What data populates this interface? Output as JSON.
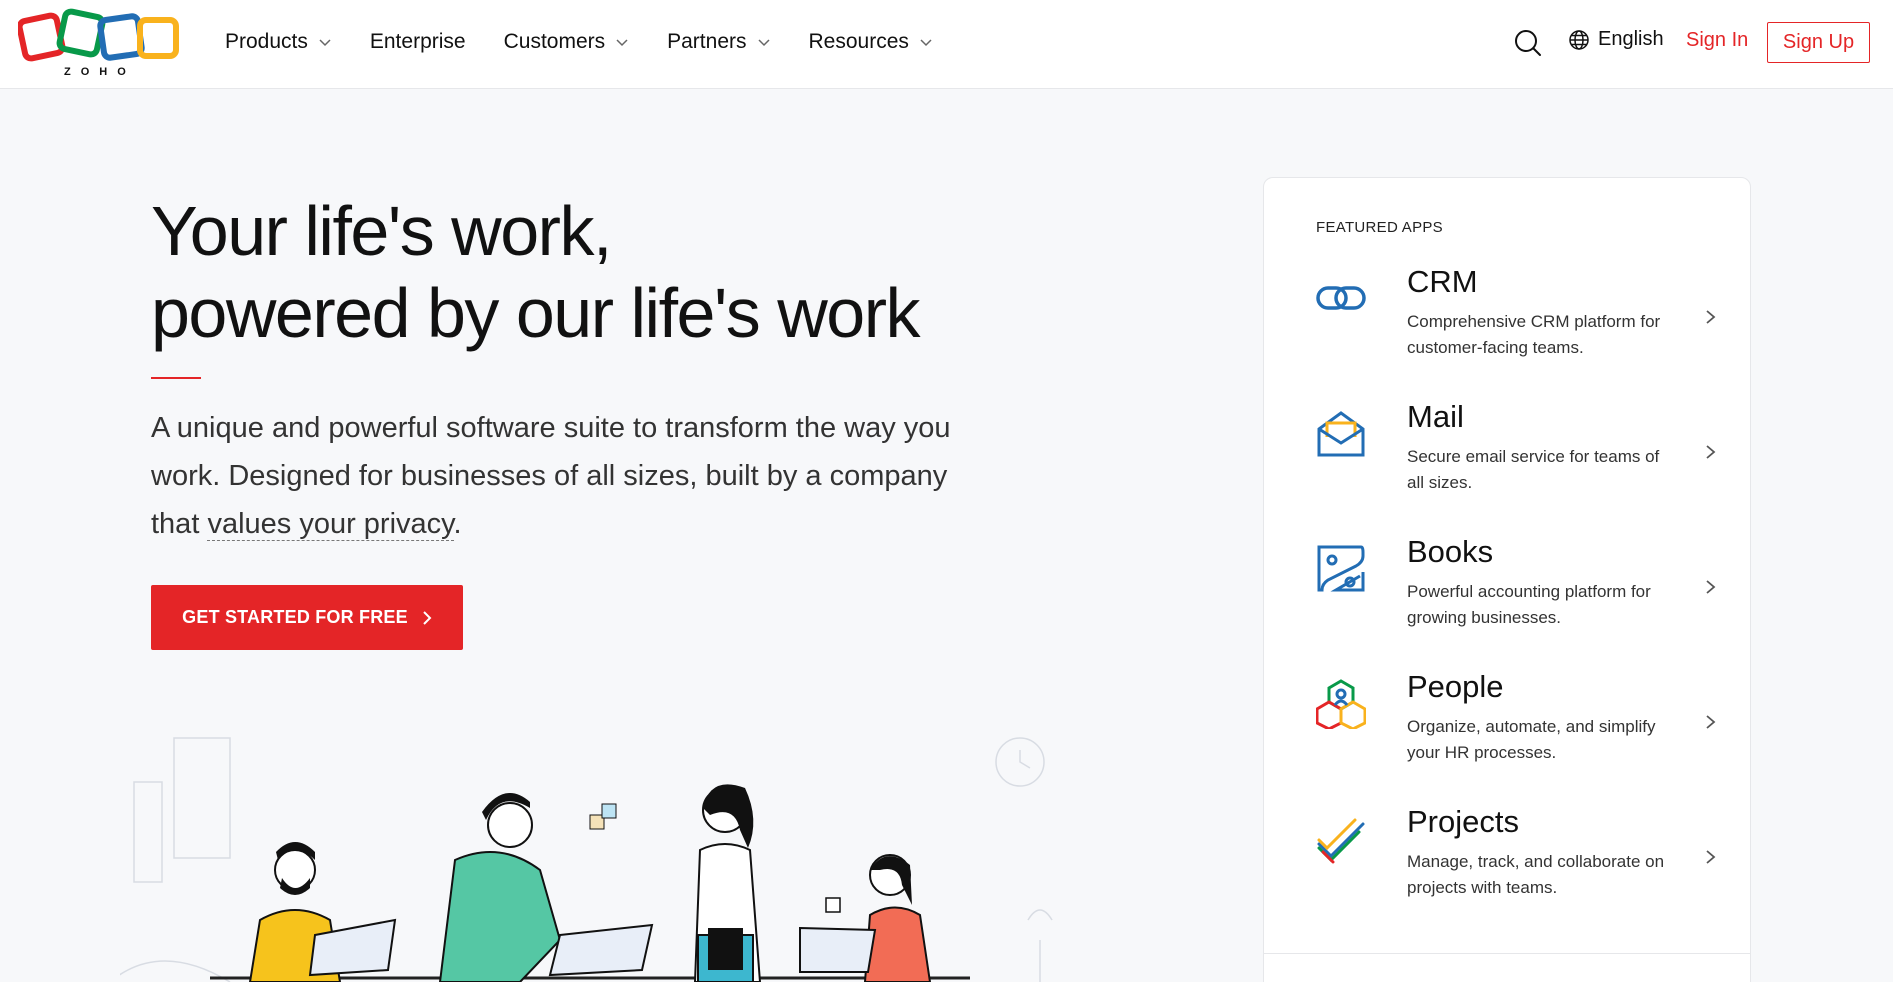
{
  "header": {
    "logo_text": "ZOHO",
    "nav": [
      {
        "label": "Products",
        "dropdown": true
      },
      {
        "label": "Enterprise",
        "dropdown": false
      },
      {
        "label": "Customers",
        "dropdown": true
      },
      {
        "label": "Partners",
        "dropdown": true
      },
      {
        "label": "Resources",
        "dropdown": true
      }
    ],
    "language": "English",
    "sign_in": "Sign In",
    "sign_up": "Sign Up"
  },
  "hero": {
    "title_line1": "Your life's work,",
    "title_line2": "powered by our life's work",
    "subtitle_pre": "A unique and powerful software suite to transform the way you work. Designed for businesses of all sizes, built by a company that ",
    "subtitle_link": "values your privacy",
    "subtitle_post": ".",
    "cta": "GET STARTED FOR FREE"
  },
  "featured": {
    "title": "FEATURED APPS",
    "apps": [
      {
        "name": "CRM",
        "desc": "Comprehensive CRM platform for customer-facing teams.",
        "icon": "crm-icon"
      },
      {
        "name": "Mail",
        "desc": "Secure email service for teams of all sizes.",
        "icon": "mail-icon"
      },
      {
        "name": "Books",
        "desc": "Powerful accounting platform for growing businesses.",
        "icon": "books-icon"
      },
      {
        "name": "People",
        "desc": "Organize, automate, and simplify your HR processes.",
        "icon": "people-icon"
      },
      {
        "name": "Projects",
        "desc": "Manage, track, and collaborate on projects with teams.",
        "icon": "projects-icon"
      }
    ]
  },
  "colors": {
    "brand_red": "#e42527",
    "logo_red": "#e42527",
    "logo_green": "#089949",
    "logo_blue": "#226db4",
    "logo_yellow": "#f9b21d"
  }
}
